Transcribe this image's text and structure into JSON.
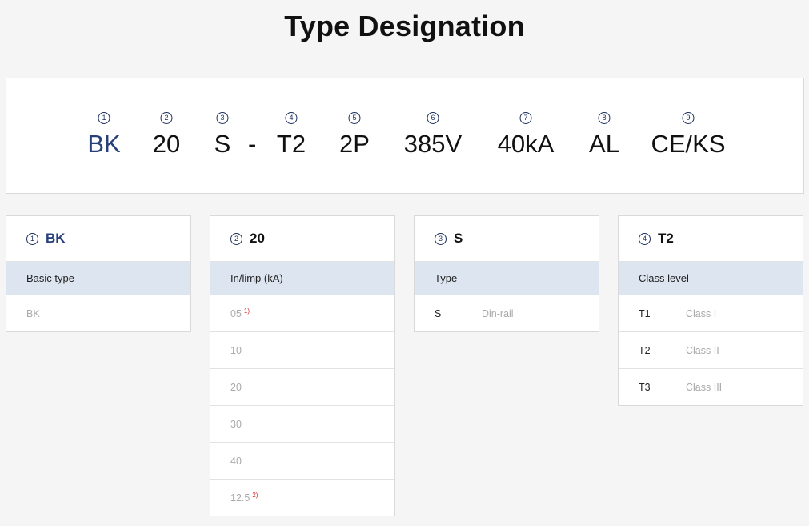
{
  "title": "Type Designation",
  "designation": [
    {
      "num": "1",
      "value": "BK",
      "highlight": true
    },
    {
      "num": "2",
      "value": "20"
    },
    {
      "num": "3",
      "value": "S"
    },
    {
      "num": "4",
      "value": "T2"
    },
    {
      "num": "5",
      "value": "2P"
    },
    {
      "num": "6",
      "value": "385V"
    },
    {
      "num": "7",
      "value": "40kA"
    },
    {
      "num": "8",
      "value": "AL"
    },
    {
      "num": "9",
      "value": "CE/KS"
    }
  ],
  "separator": "-",
  "cards": [
    {
      "num": "1",
      "value": "BK",
      "highlight": true,
      "subtitle": "Basic type",
      "rows": [
        {
          "code": "BK"
        }
      ]
    },
    {
      "num": "2",
      "value": "20",
      "subtitle": "In/limp (kA)",
      "rows": [
        {
          "code": "05",
          "note": "1)"
        },
        {
          "code": "10"
        },
        {
          "code": "20"
        },
        {
          "code": "30"
        },
        {
          "code": "40"
        },
        {
          "code": "12.5",
          "note": "2)"
        }
      ]
    },
    {
      "num": "3",
      "value": "S",
      "subtitle": "Type",
      "rows": [
        {
          "code": "S",
          "desc": "Din-rail"
        }
      ]
    },
    {
      "num": "4",
      "value": "T2",
      "subtitle": "Class level",
      "rows": [
        {
          "code": "T1",
          "desc": "Class I"
        },
        {
          "code": "T2",
          "desc": "Class II"
        },
        {
          "code": "T3",
          "desc": "Class III"
        }
      ]
    }
  ]
}
